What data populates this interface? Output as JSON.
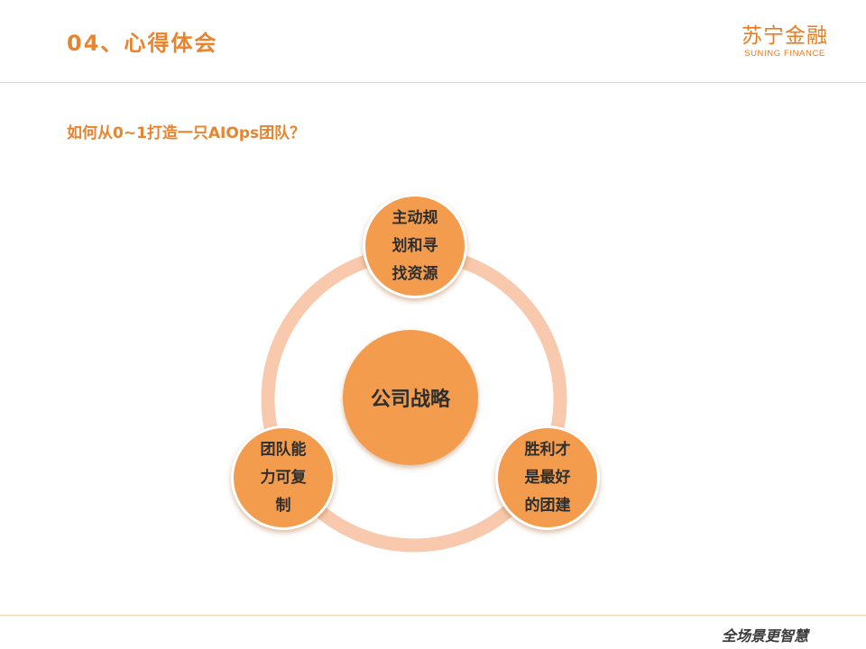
{
  "header": {
    "title": "04、心得体会",
    "logo_cn": "苏宁金融",
    "logo_en": "SUNING FINANCE"
  },
  "subtitle": "如何从0~1打造一只AIOps团队？",
  "diagram": {
    "center": "公司战略",
    "nodes": [
      {
        "label": "主动规划和寻找资源",
        "position": "top"
      },
      {
        "label": "胜利才是最好的团建",
        "position": "bottom-right"
      },
      {
        "label": "团队能力可复制",
        "position": "bottom-left"
      }
    ],
    "colors": {
      "node_fill": "#f39c4e",
      "ring": "#f8c9ac",
      "accent": "#e8832e"
    }
  },
  "footer": {
    "slogan": "全场景更智慧"
  }
}
